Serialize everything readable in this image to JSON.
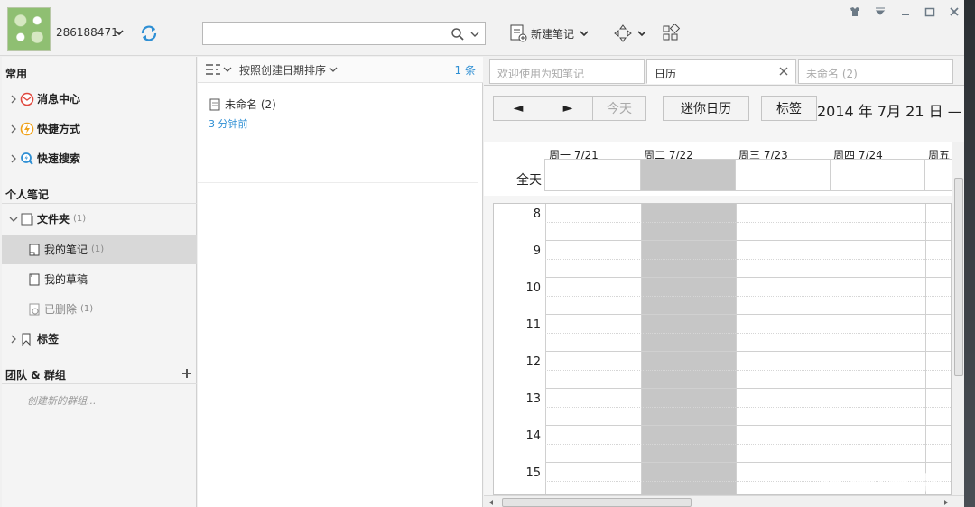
{
  "app": {
    "username": "286188471",
    "search": {
      "placeholder": ""
    },
    "new_note_label": "新建笔记"
  },
  "sidebar": {
    "section_common": "常用",
    "common_items": [
      {
        "label": "消息中心",
        "icon": "message-center-icon"
      },
      {
        "label": "快捷方式",
        "icon": "shortcut-icon"
      },
      {
        "label": "快速搜索",
        "icon": "quick-search-icon"
      }
    ],
    "section_personal": "个人笔记",
    "folder_label": "文件夹",
    "folder_count": "(1)",
    "folder_items": [
      {
        "label": "我的笔记",
        "count": "(1)",
        "selected": true
      },
      {
        "label": "我的草稿",
        "count": ""
      },
      {
        "label": "已删除",
        "count": "(1)"
      }
    ],
    "tags_label": "标签",
    "section_team": "团队 & 群组",
    "create_group": "创建新的群组..."
  },
  "notelist": {
    "sort_label": "按照创建日期排序",
    "count": "1 条",
    "notes": [
      {
        "title": "未命名 (2)",
        "time": "3 分钟前"
      }
    ]
  },
  "tabs": [
    {
      "label": "欢迎使用为知笔记",
      "active": false
    },
    {
      "label": "日历",
      "active": true
    },
    {
      "label": "未命名 (2)",
      "active": false
    }
  ],
  "calendar": {
    "prev": "◄",
    "next": "►",
    "today": "今天",
    "mini": "迷你日历",
    "tags": "标签",
    "title": "2014 年 7月 21 日 —",
    "allday": "全天",
    "days": [
      "周一 7/21",
      "周二 7/22",
      "周三 7/23",
      "周四 7/24",
      "周五"
    ],
    "hours": [
      "8",
      "9",
      "10",
      "11",
      "12",
      "13",
      "14",
      "15"
    ]
  },
  "watermark": "值 什么值得买",
  "colors": {
    "accent": "#2e8fd4",
    "today_col": "#c6c6c6",
    "selected_row": "#d8d8d8"
  }
}
